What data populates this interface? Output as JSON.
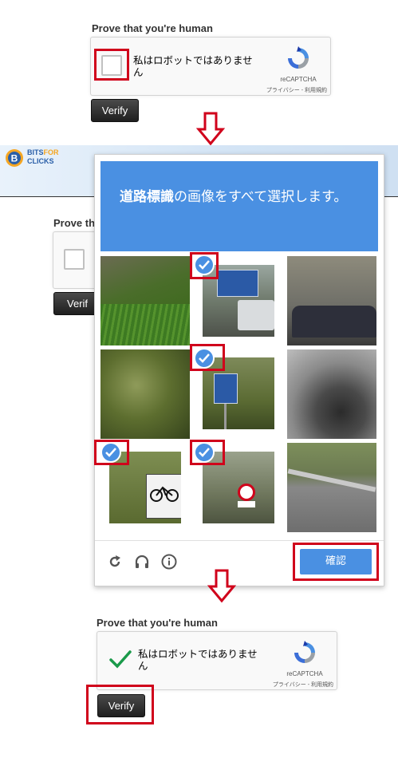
{
  "top_widget": {
    "title": "Prove that you're human",
    "checkbox_label": "私はロボットではありません",
    "brand": "reCAPTCHA",
    "terms": "プライバシー - 利用規約",
    "verify_label": "Verify"
  },
  "site": {
    "logo_text_line1": "BITS",
    "logo_text_line1b": "FOR",
    "logo_text_line2": "CLICKS",
    "bg_title_partial": "Prove th",
    "bg_verify_partial": "Verif"
  },
  "challenge": {
    "instruction_bold": "道路標識",
    "instruction_rest": "の画像をすべて選択します。",
    "confirm_label": "確認",
    "tiles": [
      {
        "subject": "grass-slope",
        "selected": false
      },
      {
        "subject": "street-signs-truck",
        "selected": true
      },
      {
        "subject": "car-road",
        "selected": false
      },
      {
        "subject": "tree-foliage",
        "selected": false
      },
      {
        "subject": "sign-tree",
        "selected": true
      },
      {
        "subject": "rock",
        "selected": false
      },
      {
        "subject": "bike-lane-sign",
        "selected": true
      },
      {
        "subject": "no-entry-sign",
        "selected": true
      },
      {
        "subject": "road-guardrail",
        "selected": false
      }
    ]
  },
  "bottom_widget": {
    "title": "Prove that you're human",
    "checkbox_label": "私はロボットではありません",
    "brand": "reCAPTCHA",
    "terms": "プライバシー - 利用規約",
    "verify_label": "Verify"
  },
  "colors": {
    "accent": "#4a90e2",
    "highlight": "#d0021b",
    "check_green": "#1a9a4a"
  }
}
